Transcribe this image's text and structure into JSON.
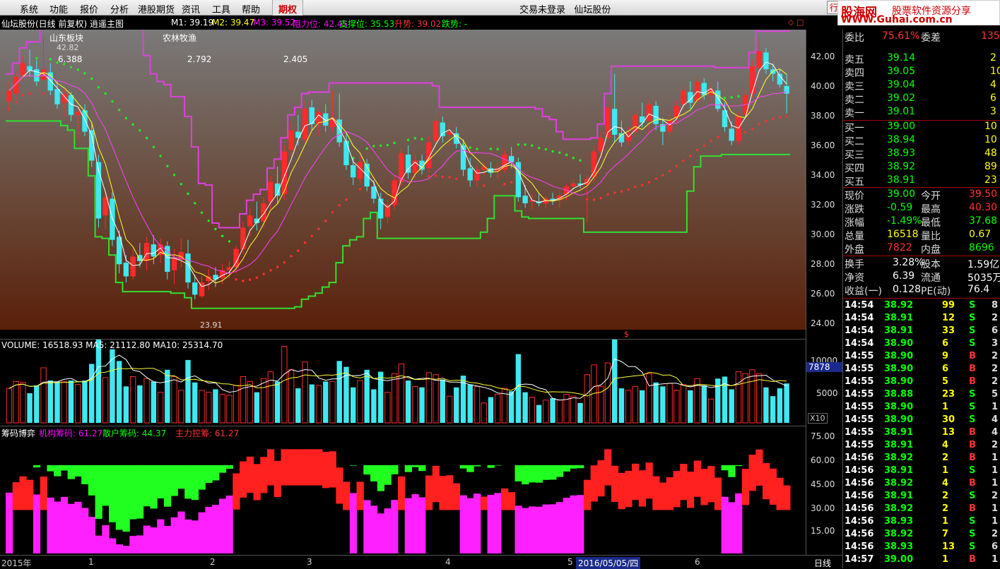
{
  "menu": [
    "系统",
    "功能",
    "报价",
    "分析",
    "港股期货",
    "资讯",
    "工具",
    "帮助",
    "期权"
  ],
  "window": {
    "login_status": "交易未登录",
    "app_name": "仙坛股份",
    "mini_button": "行"
  },
  "logo": {
    "brand": "股海网",
    "slogan": "股票软件资源分享",
    "url": "WWW.Guhai.com.cn"
  },
  "chart_header": {
    "name": "仙坛股份(日线 前复权) 逍遥主图",
    "m1": "M1: 39.19",
    "m2": "M2: 39.47",
    "m3": "M3: 39.52",
    "resist": "阻力位: 42.45",
    "support": "支撑位: 35.53",
    "up": "升势: 39.02",
    "down": "跌势: -"
  },
  "overlay": {
    "sector": "山东板块",
    "industry": "农林牧渔",
    "v1": "6.388",
    "v2": "2.792",
    "v3": "2.405",
    "high_mark": "42.82",
    "low_mark": "23.91",
    "flag": "$"
  },
  "price_axis": [
    "42.00",
    "40.00",
    "38.00",
    "36.00",
    "34.00",
    "32.00",
    "30.00",
    "28.00",
    "26.00",
    "24.00"
  ],
  "volume": {
    "header": "VOLUME: 16518.93  MA5: 21112.80  MA10: 25314.70",
    "axis": [
      "10000",
      "5000"
    ],
    "cursor": "7878",
    "multiplier": "X10"
  },
  "chip": {
    "title": "筹码博弈",
    "inst": "机构筹码: 61.27",
    "retail": "散户筹码: 44.37",
    "main": "主力控筹: 61.27",
    "axis": [
      "75.00",
      "60.00",
      "45.00",
      "30.00",
      "15.00"
    ]
  },
  "dates": {
    "labels": [
      "2015年",
      "1",
      "2",
      "3",
      "4",
      "5",
      "6"
    ],
    "cursor": "2016/05/05/四",
    "period": "日线"
  },
  "quote": {
    "partial": [
      "委比",
      "75.61%",
      "委差",
      "135"
    ],
    "asks": [
      [
        "卖五",
        "39.14",
        "2"
      ],
      [
        "卖四",
        "39.05",
        "10"
      ],
      [
        "卖三",
        "39.04",
        "4"
      ],
      [
        "卖二",
        "39.02",
        "6"
      ],
      [
        "卖一",
        "39.01",
        "3"
      ]
    ],
    "bids": [
      [
        "买一",
        "39.00",
        "10"
      ],
      [
        "买二",
        "38.94",
        "10"
      ],
      [
        "买三",
        "38.93",
        "48"
      ],
      [
        "买四",
        "38.92",
        "89"
      ],
      [
        "买五",
        "38.91",
        "23"
      ]
    ],
    "stats": [
      [
        "现价",
        "39.00",
        "今开",
        "39.50"
      ],
      [
        "涨跌",
        "-0.59",
        "最高",
        "40.30"
      ],
      [
        "涨幅",
        "-1.49%",
        "最低",
        "37.68"
      ],
      [
        "总量",
        "16518",
        "量比",
        "0.67"
      ],
      [
        "外盘",
        "7822",
        "内盘",
        "8696"
      ]
    ],
    "fund": [
      [
        "换手",
        "3.28%",
        "股本",
        "1.59亿"
      ],
      [
        "净资",
        "6.39",
        "流通",
        "5035万"
      ],
      [
        "收益(一)",
        "0.128",
        "PE(动)",
        "76.4"
      ]
    ],
    "trades": [
      [
        "14:54",
        "38.92",
        "99",
        "S",
        "8"
      ],
      [
        "14:54",
        "38.91",
        "12",
        "S",
        "2"
      ],
      [
        "14:54",
        "38.91",
        "33",
        "S",
        "6"
      ],
      [
        "14:54",
        "38.90",
        "6",
        "S",
        "3"
      ],
      [
        "14:55",
        "38.90",
        "9",
        "B",
        "2"
      ],
      [
        "14:55",
        "38.90",
        "6",
        "B",
        "2"
      ],
      [
        "14:55",
        "38.90",
        "5",
        "B",
        "2"
      ],
      [
        "14:55",
        "38.88",
        "23",
        "S",
        "5"
      ],
      [
        "14:55",
        "38.90",
        "1",
        "S",
        "1"
      ],
      [
        "14:55",
        "38.90",
        "30",
        "S",
        "4"
      ],
      [
        "14:55",
        "38.91",
        "13",
        "B",
        "4"
      ],
      [
        "14:55",
        "38.91",
        "4",
        "B",
        "2"
      ],
      [
        "14:56",
        "38.92",
        "2",
        "B",
        "1"
      ],
      [
        "14:56",
        "38.91",
        "1",
        "S",
        "1"
      ],
      [
        "14:56",
        "38.92",
        "4",
        "B",
        "1"
      ],
      [
        "14:56",
        "38.91",
        "2",
        "S",
        "2"
      ],
      [
        "14:56",
        "38.92",
        "2",
        "B",
        "1"
      ],
      [
        "14:56",
        "38.93",
        "1",
        "S",
        "1"
      ],
      [
        "14:56",
        "38.92",
        "7",
        "S",
        "2"
      ],
      [
        "14:56",
        "38.93",
        "13",
        "S",
        "6"
      ],
      [
        "14:57",
        "39.00",
        "1",
        "B",
        "1"
      ]
    ]
  },
  "chart_data": {
    "type": "candlestick",
    "price_range": [
      23.5,
      43.2
    ],
    "candles": [
      [
        38.5,
        39.8,
        37.8,
        39.2
      ],
      [
        39.0,
        40.5,
        38.6,
        40.1
      ],
      [
        40.2,
        41.5,
        39.8,
        41.0
      ],
      [
        40.8,
        41.9,
        40.1,
        40.5
      ],
      [
        40.6,
        41.2,
        39.5,
        39.8
      ],
      [
        39.9,
        42.8,
        39.6,
        40.6
      ],
      [
        40.4,
        41.0,
        38.9,
        39.2
      ],
      [
        39.3,
        39.8,
        38.0,
        38.3
      ],
      [
        38.4,
        39.3,
        37.5,
        39.0
      ],
      [
        38.9,
        39.1,
        37.2,
        37.6
      ],
      [
        37.6,
        38.2,
        36.0,
        37.8
      ],
      [
        37.9,
        38.3,
        36.2,
        36.5
      ],
      [
        36.6,
        37.0,
        34.2,
        34.6
      ],
      [
        34.5,
        35.0,
        30.2,
        30.8
      ],
      [
        31.0,
        32.6,
        30.1,
        32.2
      ],
      [
        32.1,
        32.5,
        29.0,
        29.4
      ],
      [
        29.6,
        30.0,
        27.2,
        27.8
      ],
      [
        27.9,
        28.4,
        26.6,
        27.0
      ],
      [
        27.0,
        28.8,
        26.8,
        28.3
      ],
      [
        28.4,
        29.2,
        27.6,
        28.0
      ],
      [
        28.0,
        29.6,
        27.4,
        29.2
      ],
      [
        29.1,
        29.7,
        27.8,
        28.3
      ],
      [
        28.4,
        29.5,
        27.9,
        29.1
      ],
      [
        29.0,
        29.3,
        26.8,
        27.3
      ],
      [
        27.4,
        28.8,
        26.5,
        28.2
      ],
      [
        28.1,
        29.5,
        27.6,
        28.6
      ],
      [
        28.5,
        29.4,
        26.2,
        26.6
      ],
      [
        26.6,
        27.1,
        25.5,
        25.8
      ],
      [
        25.7,
        27.0,
        25.6,
        26.6
      ],
      [
        26.7,
        27.5,
        26.1,
        27.0
      ],
      [
        27.1,
        27.6,
        26.3,
        26.8
      ],
      [
        26.9,
        27.8,
        26.5,
        27.4
      ],
      [
        27.4,
        28.0,
        26.9,
        27.6
      ],
      [
        27.6,
        29.0,
        27.2,
        28.8
      ],
      [
        28.8,
        30.6,
        28.5,
        30.2
      ],
      [
        30.3,
        31.5,
        29.6,
        31.0
      ],
      [
        30.8,
        31.9,
        30.0,
        30.5
      ],
      [
        30.6,
        32.2,
        30.2,
        31.8
      ],
      [
        31.9,
        33.6,
        31.4,
        33.2
      ],
      [
        33.1,
        34.2,
        31.8,
        32.3
      ],
      [
        32.4,
        35.6,
        32.0,
        35.2
      ],
      [
        35.3,
        37.1,
        34.8,
        36.6
      ],
      [
        36.5,
        37.6,
        35.6,
        36.1
      ],
      [
        36.0,
        38.5,
        35.8,
        38.0
      ],
      [
        38.1,
        38.6,
        36.6,
        37.0
      ],
      [
        37.0,
        38.0,
        36.2,
        37.8
      ],
      [
        37.7,
        38.3,
        36.5,
        36.9
      ],
      [
        36.8,
        39.2,
        36.5,
        37.4
      ],
      [
        37.3,
        39.0,
        35.5,
        35.8
      ],
      [
        35.9,
        36.4,
        34.0,
        34.3
      ],
      [
        34.3,
        34.8,
        33.0,
        33.5
      ],
      [
        33.4,
        34.9,
        33.1,
        34.5
      ],
      [
        34.4,
        34.7,
        32.6,
        32.9
      ],
      [
        32.9,
        33.3,
        31.8,
        32.1
      ],
      [
        32.1,
        32.5,
        30.1,
        30.8
      ],
      [
        30.9,
        32.0,
        30.5,
        31.7
      ],
      [
        31.7,
        33.6,
        31.4,
        33.3
      ],
      [
        33.2,
        35.4,
        32.9,
        35.1
      ],
      [
        35.0,
        35.6,
        33.4,
        33.8
      ],
      [
        33.8,
        35.0,
        33.4,
        34.6
      ],
      [
        34.6,
        35.0,
        33.7,
        34.0
      ],
      [
        34.1,
        36.2,
        33.8,
        35.8
      ],
      [
        35.9,
        37.6,
        35.4,
        37.2
      ],
      [
        37.1,
        37.5,
        35.8,
        36.2
      ],
      [
        36.3,
        37.0,
        35.6,
        36.5
      ],
      [
        36.4,
        36.8,
        35.4,
        35.7
      ],
      [
        35.6,
        36.0,
        33.6,
        34.0
      ],
      [
        34.1,
        34.8,
        32.9,
        33.3
      ],
      [
        33.3,
        34.3,
        32.9,
        34.0
      ],
      [
        34.0,
        34.5,
        33.6,
        34.2
      ],
      [
        34.1,
        34.5,
        33.5,
        33.8
      ],
      [
        33.9,
        34.4,
        33.4,
        34.1
      ],
      [
        34.0,
        35.3,
        33.8,
        35.0
      ],
      [
        34.9,
        35.5,
        34.1,
        34.5
      ],
      [
        34.5,
        34.8,
        31.9,
        32.2
      ],
      [
        32.3,
        33.0,
        31.5,
        31.8
      ],
      [
        31.9,
        32.4,
        31.4,
        32.0
      ],
      [
        31.9,
        32.5,
        31.6,
        31.8
      ],
      [
        31.8,
        32.3,
        31.5,
        32.1
      ],
      [
        32.1,
        32.5,
        31.7,
        32.0
      ],
      [
        32.0,
        32.6,
        31.5,
        32.3
      ],
      [
        32.4,
        33.1,
        32.0,
        32.9
      ],
      [
        32.9,
        33.4,
        32.6,
        33.1
      ],
      [
        33.1,
        33.7,
        32.8,
        33.0
      ],
      [
        33.0,
        33.6,
        30.5,
        33.4
      ],
      [
        33.5,
        35.6,
        33.2,
        35.2
      ],
      [
        35.2,
        36.5,
        34.8,
        36.1
      ],
      [
        36.1,
        38.5,
        35.9,
        38.1
      ],
      [
        38.0,
        40.3,
        35.8,
        36.3
      ],
      [
        36.4,
        37.2,
        35.5,
        35.8
      ],
      [
        35.9,
        36.8,
        35.6,
        36.4
      ],
      [
        36.5,
        37.9,
        36.2,
        37.6
      ],
      [
        37.5,
        38.4,
        36.8,
        37.1
      ],
      [
        37.2,
        38.6,
        36.4,
        38.3
      ],
      [
        38.2,
        38.5,
        36.6,
        37.0
      ],
      [
        37.0,
        37.4,
        35.6,
        36.5
      ],
      [
        36.5,
        37.6,
        36.2,
        37.3
      ],
      [
        37.4,
        38.5,
        37.1,
        38.2
      ],
      [
        38.3,
        39.5,
        38.0,
        39.2
      ],
      [
        39.1,
        39.8,
        38.0,
        38.4
      ],
      [
        38.5,
        40.2,
        38.2,
        39.8
      ],
      [
        39.7,
        40.0,
        38.6,
        38.9
      ],
      [
        38.9,
        39.5,
        38.4,
        39.3
      ],
      [
        39.2,
        39.8,
        37.8,
        38.0
      ],
      [
        37.9,
        38.4,
        36.5,
        36.8
      ],
      [
        36.7,
        37.2,
        35.6,
        35.9
      ],
      [
        35.9,
        37.8,
        35.6,
        37.5
      ],
      [
        37.6,
        39.2,
        37.3,
        38.9
      ],
      [
        39.0,
        41.2,
        38.7,
        40.8
      ],
      [
        40.7,
        42.6,
        40.2,
        41.8
      ],
      [
        41.7,
        42.0,
        40.3,
        40.6
      ],
      [
        40.6,
        41.0,
        39.8,
        40.3
      ],
      [
        40.3,
        40.6,
        39.4,
        39.6
      ],
      [
        39.5,
        40.3,
        37.7,
        39.0
      ]
    ]
  }
}
